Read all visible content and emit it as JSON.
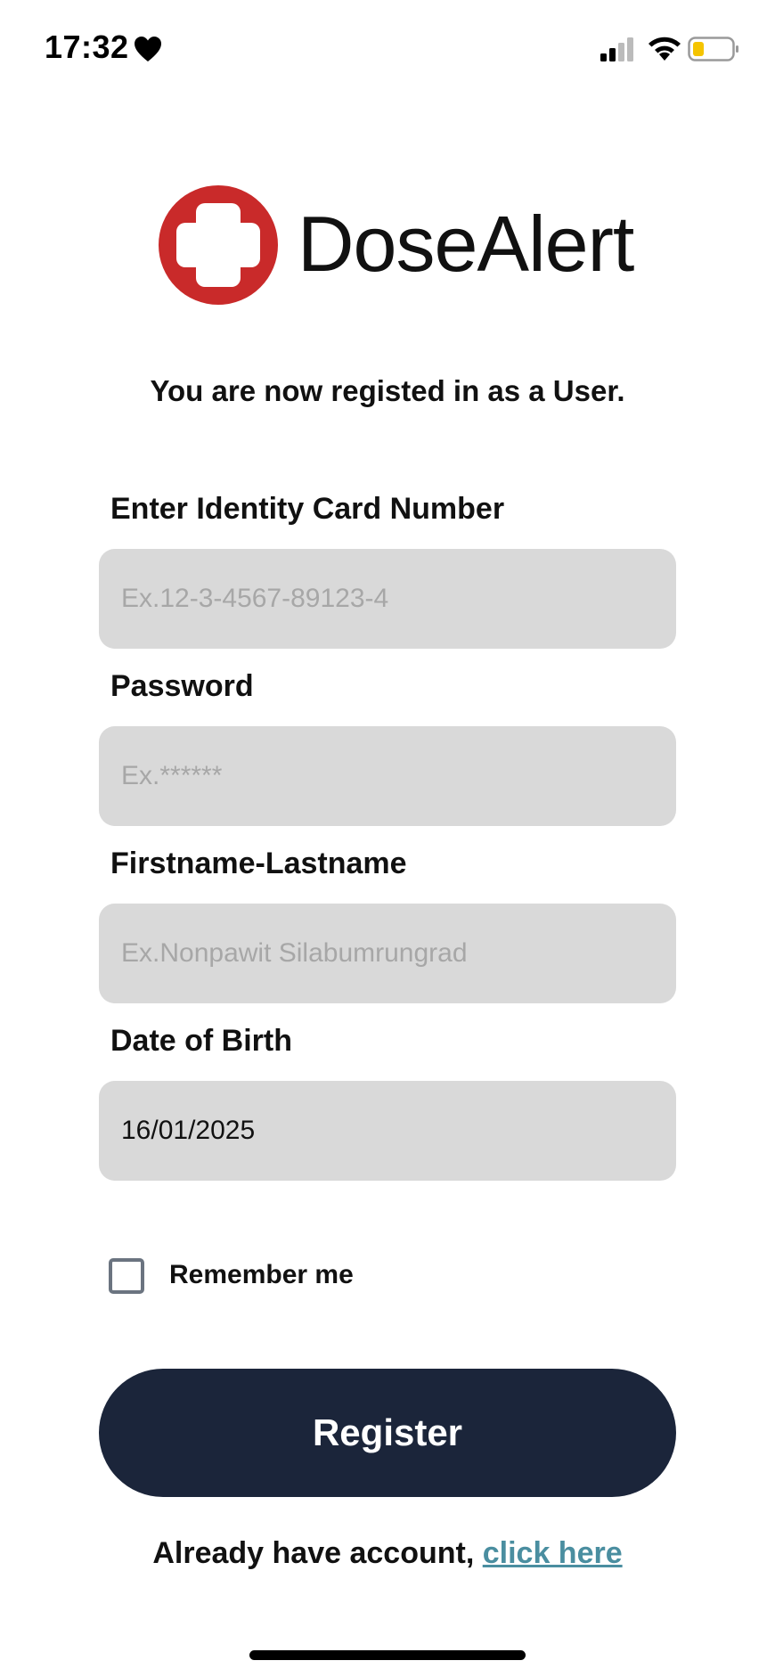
{
  "status_bar": {
    "time": "17:32",
    "icons": [
      "heart-icon",
      "signal-icon",
      "wifi-icon",
      "battery-icon"
    ],
    "battery_color": "#f5c400"
  },
  "app": {
    "name": "DoseAlert",
    "logo_color": "#c92a2a"
  },
  "subtitle": "You are now registed in as a User.",
  "form": {
    "id_label": "Enter Identity Card Number",
    "id_placeholder": "Ex.12-3-4567-89123-4",
    "id_value": "",
    "password_label": "Password",
    "password_placeholder": "Ex.******",
    "password_value": "",
    "name_label": "Firstname-Lastname",
    "name_placeholder": "Ex.Nonpawit Silabumrungrad",
    "name_value": "",
    "dob_label": "Date of Birth",
    "dob_value": "16/01/2025",
    "remember_label": "Remember me",
    "remember_checked": false
  },
  "register_button": "Register",
  "footer": {
    "text": "Already have account, ",
    "link": "click here"
  },
  "colors": {
    "button_bg": "#1b253a",
    "field_bg": "#d9d9d9",
    "link": "#4a8ea0"
  }
}
